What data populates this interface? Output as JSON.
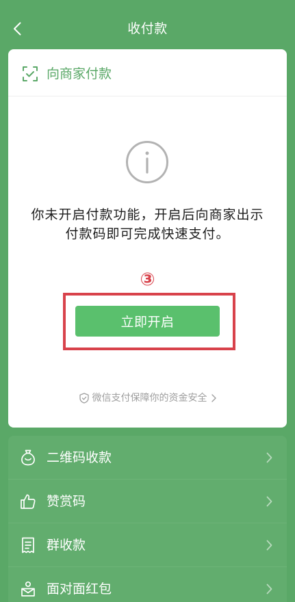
{
  "nav": {
    "title": "收付款",
    "back_icon": "back-chevron-icon"
  },
  "pay_card": {
    "header_icon": "scan-frame-icon",
    "header_label": "向商家付款",
    "status_icon": "info-circle-icon",
    "message_lines": [
      "你未开启付款功能，开启后向商家出示",
      "付款码即可完成快速支付。"
    ],
    "step_marker": "③",
    "enable_button_label": "立即开启",
    "security_icon": "shield-icon",
    "security_note": "微信支付保障你的资金安全"
  },
  "menu": {
    "items": [
      {
        "label": "二维码收款",
        "icon": "money-bag-icon"
      },
      {
        "label": "赞赏码",
        "icon": "thumbs-up-icon"
      },
      {
        "label": "群收款",
        "icon": "receipt-icon"
      },
      {
        "label": "面对面红包",
        "icon": "red-packet-icon"
      }
    ]
  },
  "colors": {
    "background": "#5aa867",
    "menu_background": "#62ad6e",
    "menu_divider": "#6db478",
    "accent_green": "#5ac06d",
    "header_green": "#5aa867",
    "annotation_red": "#d8424b",
    "text_dark": "#1b1b1b",
    "text_muted": "#9e9e9e",
    "icon_gray": "#b2b2b2"
  }
}
